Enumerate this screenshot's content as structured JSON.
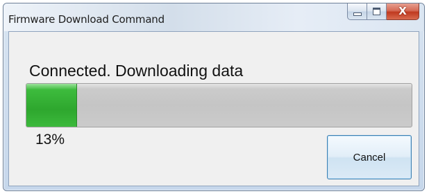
{
  "window": {
    "title": "Firmware Download Command",
    "controls": {
      "minimize_icon": "minimize-icon",
      "maximize_icon": "maximize-icon",
      "close_icon": "close-icon",
      "close_glyph": "X"
    }
  },
  "dialog": {
    "status_text": "Connected. Downloading data",
    "progress": {
      "value_percent": 13,
      "label": "13%"
    },
    "cancel_label": "Cancel"
  },
  "colors": {
    "progress_fill": "#2ea72e",
    "progress_track": "#c5c5c5",
    "close_button": "#c0391f",
    "cancel_border": "#3c7fb1"
  }
}
